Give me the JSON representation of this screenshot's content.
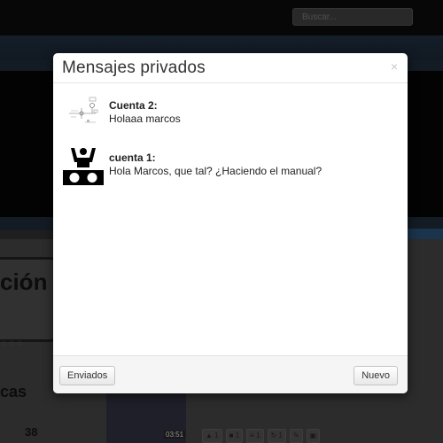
{
  "background": {
    "search_placeholder": "Buscar...",
    "card_text": "ción",
    "stars": "☆☆☆",
    "section_text": "cas",
    "count": "38",
    "video_time": "03:51",
    "actions": [
      {
        "icon": "thumbs-up-icon",
        "count": "1"
      },
      {
        "icon": "comment-icon",
        "count": "1"
      },
      {
        "icon": "list-icon",
        "count": "1"
      },
      {
        "icon": "retweet-icon",
        "count": "1"
      },
      {
        "icon": "pencil-icon",
        "count": ""
      },
      {
        "icon": "trash-icon",
        "count": ""
      }
    ]
  },
  "modal": {
    "title": "Mensajes privados",
    "close_symbol": "×",
    "messages": [
      {
        "author": "Cuenta 2:",
        "text": "Holaaa marcos",
        "avatar_icon": "diagram-avatar-icon"
      },
      {
        "author": "cuenta 1:",
        "text": "Hola Marcos, que tal? ¿Haciendo el manual?",
        "avatar_icon": "dj-avatar-icon"
      }
    ],
    "footer": {
      "left_button": "Enviados",
      "right_button": "Nuevo"
    }
  }
}
